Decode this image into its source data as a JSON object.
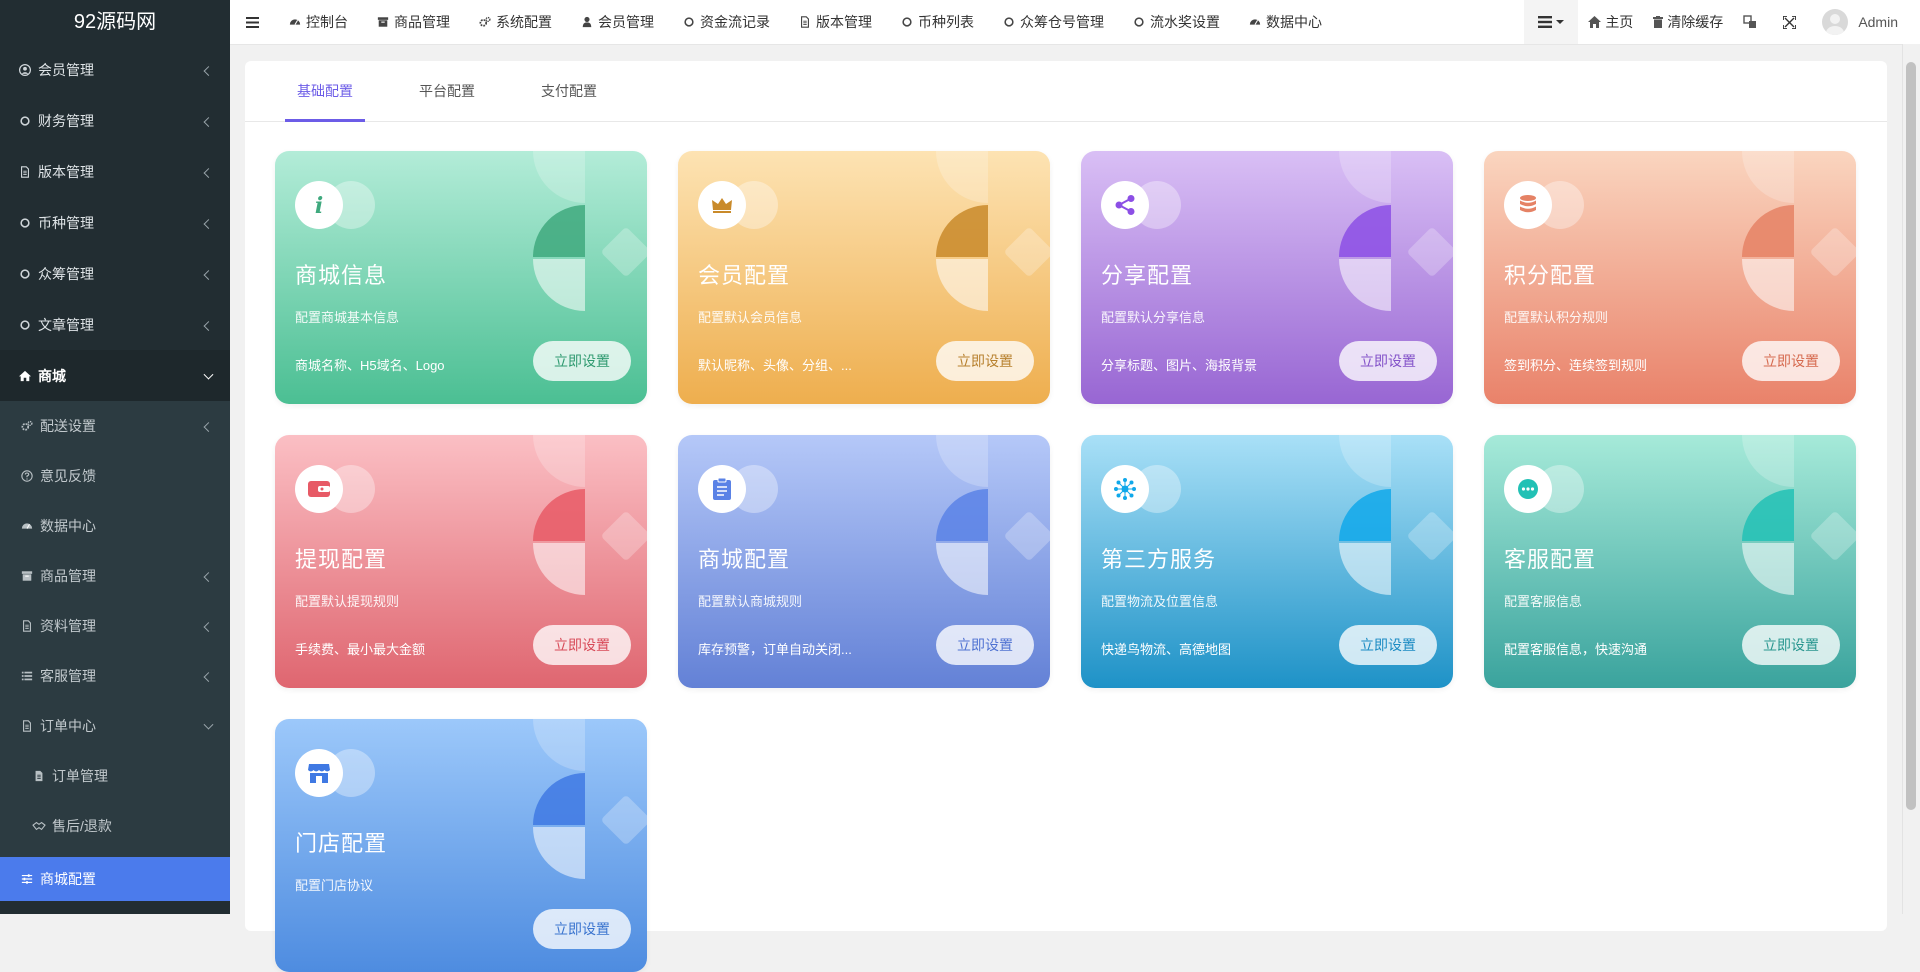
{
  "brand": "92源码网",
  "sidebar": {
    "items": [
      {
        "label": "会员管理",
        "icon": "user-circle-icon"
      },
      {
        "label": "财务管理",
        "icon": "circle-icon"
      },
      {
        "label": "版本管理",
        "icon": "file-icon"
      },
      {
        "label": "币种管理",
        "icon": "circle-icon"
      },
      {
        "label": "众筹管理",
        "icon": "circle-icon"
      },
      {
        "label": "文章管理",
        "icon": "circle-icon"
      },
      {
        "label": "商城",
        "icon": "home-icon"
      }
    ],
    "sub_items": [
      {
        "label": "配送设置",
        "icon": "gears-icon"
      },
      {
        "label": "意见反馈",
        "icon": "question-icon"
      },
      {
        "label": "数据中心",
        "icon": "dashboard-icon"
      },
      {
        "label": "商品管理",
        "icon": "archive-icon"
      },
      {
        "label": "资料管理",
        "icon": "file-icon"
      },
      {
        "label": "客服管理",
        "icon": "list-icon"
      },
      {
        "label": "订单中心",
        "icon": "file-icon"
      },
      {
        "label": "订单管理",
        "icon": "file-text-icon"
      },
      {
        "label": "售后/退款",
        "icon": "handshake-icon"
      },
      {
        "label": "商城配置",
        "icon": "sliders-icon"
      }
    ]
  },
  "topnav": {
    "items": [
      {
        "label": "控制台",
        "icon": "dashboard-icon"
      },
      {
        "label": "商品管理",
        "icon": "archive-icon"
      },
      {
        "label": "系统配置",
        "icon": "gears-icon"
      },
      {
        "label": "会员管理",
        "icon": "user-icon"
      },
      {
        "label": "资金流记录",
        "icon": "circle-icon"
      },
      {
        "label": "版本管理",
        "icon": "file-icon"
      },
      {
        "label": "币种列表",
        "icon": "circle-icon"
      },
      {
        "label": "众筹仓号管理",
        "icon": "circle-icon"
      },
      {
        "label": "流水奖设置",
        "icon": "circle-icon"
      },
      {
        "label": "数据中心",
        "icon": "dashboard-icon"
      }
    ],
    "home": "主页",
    "clear_cache": "清除缓存",
    "user": "Admin"
  },
  "tabs": [
    "基础配置",
    "平台配置",
    "支付配置"
  ],
  "active_tab": 0,
  "cards": [
    {
      "title": "商城信息",
      "sub": "配置商城基本信息",
      "detail": "商城名称、H5域名、Logo",
      "button": "立即设置",
      "icon": "info-icon",
      "colors": {
        "top": "#b3ecd8",
        "bottom": "#4bbf93",
        "accent": "#3fa97e",
        "text": "#2f9a70"
      }
    },
    {
      "title": "会员配置",
      "sub": "配置默认会员信息",
      "detail": "默认昵称、头像、分组、...",
      "button": "立即设置",
      "icon": "crown-icon",
      "colors": {
        "top": "#fde3b3",
        "bottom": "#eeae4e",
        "accent": "#c98a2a",
        "text": "#b7812e"
      }
    },
    {
      "title": "分享配置",
      "sub": "配置默认分享信息",
      "detail": "分享标题、图片、海报背景",
      "button": "立即设置",
      "icon": "share-icon",
      "colors": {
        "top": "#d9bff5",
        "bottom": "#9866d3",
        "accent": "#8c4fe5",
        "text": "#8352c9"
      }
    },
    {
      "title": "积分配置",
      "sub": "配置默认积分规则",
      "detail": "签到积分、连续签到规则",
      "button": "立即设置",
      "icon": "database-icon",
      "colors": {
        "top": "#fad5bf",
        "bottom": "#e9826a",
        "accent": "#e58265",
        "text": "#d66a4f"
      }
    },
    {
      "title": "提现配置",
      "sub": "配置默认提现规则",
      "detail": "手续费、最小最大金额",
      "button": "立即设置",
      "icon": "wallet-icon",
      "colors": {
        "top": "#fbbfc4",
        "bottom": "#df6670",
        "accent": "#e75a66",
        "text": "#d84a58"
      }
    },
    {
      "title": "商城配置",
      "sub": "配置默认商城规则",
      "detail": "库存预警，订单自动关闭...",
      "button": "立即设置",
      "icon": "clipboard-icon",
      "colors": {
        "top": "#b5c8f8",
        "bottom": "#6381d6",
        "accent": "#5a82e6",
        "text": "#4f72d2"
      }
    },
    {
      "title": "第三方服务",
      "sub": "配置物流及位置信息",
      "detail": "快递鸟物流、高德地图",
      "button": "立即设置",
      "icon": "network-icon",
      "colors": {
        "top": "#a9e0f7",
        "bottom": "#1e92c7",
        "accent": "#10a8ea",
        "text": "#1b8bc3"
      }
    },
    {
      "title": "客服配置",
      "sub": "配置客服信息",
      "detail": "配置客服信息，快速沟通",
      "button": "立即设置",
      "icon": "chat-icon",
      "colors": {
        "top": "#a6ead9",
        "bottom": "#3aa39d",
        "accent": "#22c1b5",
        "text": "#28968f"
      }
    },
    {
      "title": "门店配置",
      "sub": "配置门店协议",
      "detail": "",
      "button": "立即设置",
      "icon": "store-icon",
      "colors": {
        "top": "#9cc8fa",
        "bottom": "#4e8ce0",
        "accent": "#3f79e3",
        "text": "#3a74cf"
      }
    }
  ]
}
